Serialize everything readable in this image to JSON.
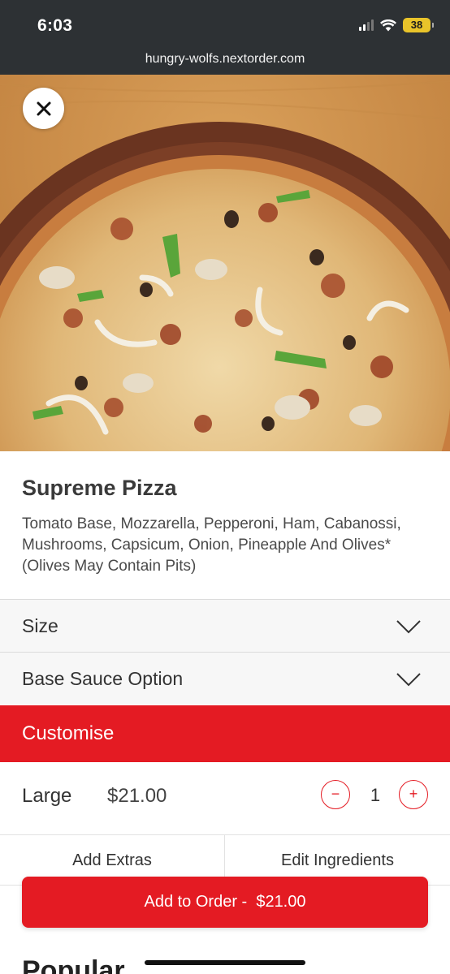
{
  "status_bar": {
    "time": "6:03",
    "battery": "38",
    "icons": [
      "cellular-signal-icon",
      "wifi-icon",
      "battery-icon"
    ]
  },
  "browser": {
    "url": "hungry-wolfs.nextorder.com"
  },
  "product": {
    "image": "supreme-pizza-photo",
    "title": "Supreme Pizza",
    "description": "Tomato Base, Mozzarella, Pepperoni, Ham, Cabanossi, Mushrooms, Capsicum, Onion, Pineapple And Olives* (Olives May Contain Pits)"
  },
  "options": [
    {
      "label": "Size",
      "icon": "chevron-down-icon"
    },
    {
      "label": "Base Sauce Option",
      "icon": "chevron-down-icon"
    }
  ],
  "customise": {
    "label": "Customise"
  },
  "selection": {
    "size": "Large",
    "price": "$21.00",
    "quantity": "1",
    "decrement_symbol": "−",
    "increment_symbol": "+"
  },
  "tabs": {
    "add_extras": "Add Extras",
    "edit_ingredients": "Edit Ingredients"
  },
  "cta": {
    "label": "Add to Order -  $21.00"
  },
  "section": {
    "heading": "Popular"
  },
  "colors": {
    "accent": "#e41b23",
    "status_bar": "#2d3134",
    "battery": "#e9c42a"
  }
}
